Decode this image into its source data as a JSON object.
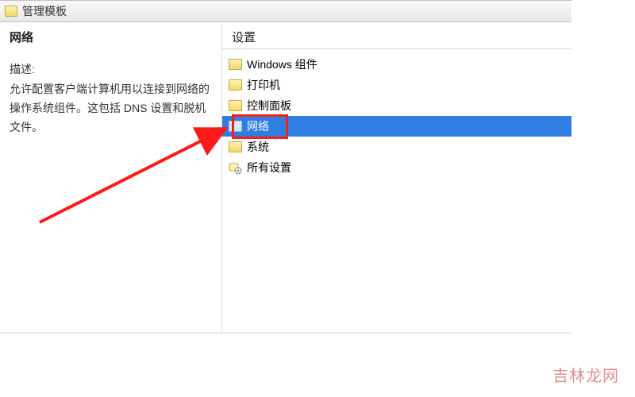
{
  "titlebar": {
    "title": "管理模板"
  },
  "left": {
    "heading": "网络",
    "desc_label": "描述:",
    "desc_text": "允许配置客户端计算机用以连接到网络的操作系统组件。这包括 DNS 设置和脱机文件。"
  },
  "right": {
    "heading": "设置",
    "items": [
      {
        "label": "Windows 组件",
        "icon": "folder"
      },
      {
        "label": "打印机",
        "icon": "folder"
      },
      {
        "label": "控制面板",
        "icon": "folder"
      },
      {
        "label": "网络",
        "icon": "folder",
        "selected": true
      },
      {
        "label": "系统",
        "icon": "folder"
      },
      {
        "label": "所有设置",
        "icon": "gear"
      }
    ]
  },
  "watermark": "吉林龙网"
}
